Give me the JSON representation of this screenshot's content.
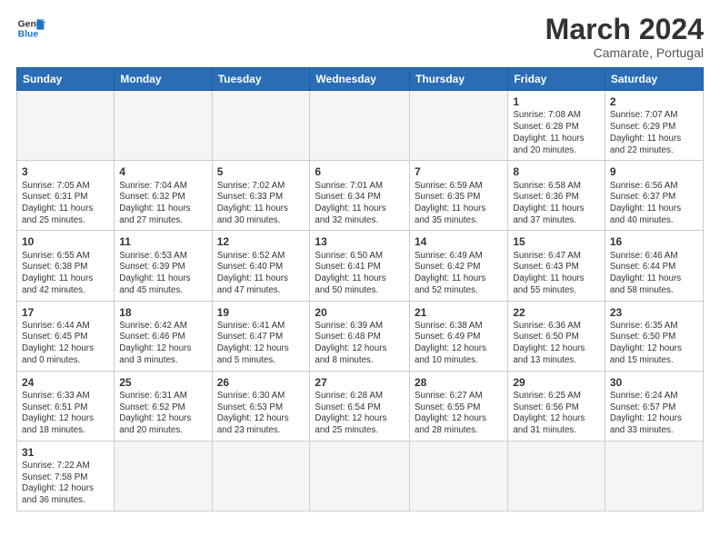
{
  "header": {
    "logo_general": "General",
    "logo_blue": "Blue",
    "title": "March 2024",
    "subtitle": "Camarate, Portugal"
  },
  "weekdays": [
    "Sunday",
    "Monday",
    "Tuesday",
    "Wednesday",
    "Thursday",
    "Friday",
    "Saturday"
  ],
  "weeks": [
    [
      {
        "day": "",
        "info": ""
      },
      {
        "day": "",
        "info": ""
      },
      {
        "day": "",
        "info": ""
      },
      {
        "day": "",
        "info": ""
      },
      {
        "day": "",
        "info": ""
      },
      {
        "day": "1",
        "info": "Sunrise: 7:08 AM\nSunset: 6:28 PM\nDaylight: 11 hours\nand 20 minutes."
      },
      {
        "day": "2",
        "info": "Sunrise: 7:07 AM\nSunset: 6:29 PM\nDaylight: 11 hours\nand 22 minutes."
      }
    ],
    [
      {
        "day": "3",
        "info": "Sunrise: 7:05 AM\nSunset: 6:31 PM\nDaylight: 11 hours\nand 25 minutes."
      },
      {
        "day": "4",
        "info": "Sunrise: 7:04 AM\nSunset: 6:32 PM\nDaylight: 11 hours\nand 27 minutes."
      },
      {
        "day": "5",
        "info": "Sunrise: 7:02 AM\nSunset: 6:33 PM\nDaylight: 11 hours\nand 30 minutes."
      },
      {
        "day": "6",
        "info": "Sunrise: 7:01 AM\nSunset: 6:34 PM\nDaylight: 11 hours\nand 32 minutes."
      },
      {
        "day": "7",
        "info": "Sunrise: 6:59 AM\nSunset: 6:35 PM\nDaylight: 11 hours\nand 35 minutes."
      },
      {
        "day": "8",
        "info": "Sunrise: 6:58 AM\nSunset: 6:36 PM\nDaylight: 11 hours\nand 37 minutes."
      },
      {
        "day": "9",
        "info": "Sunrise: 6:56 AM\nSunset: 6:37 PM\nDaylight: 11 hours\nand 40 minutes."
      }
    ],
    [
      {
        "day": "10",
        "info": "Sunrise: 6:55 AM\nSunset: 6:38 PM\nDaylight: 11 hours\nand 42 minutes."
      },
      {
        "day": "11",
        "info": "Sunrise: 6:53 AM\nSunset: 6:39 PM\nDaylight: 11 hours\nand 45 minutes."
      },
      {
        "day": "12",
        "info": "Sunrise: 6:52 AM\nSunset: 6:40 PM\nDaylight: 11 hours\nand 47 minutes."
      },
      {
        "day": "13",
        "info": "Sunrise: 6:50 AM\nSunset: 6:41 PM\nDaylight: 11 hours\nand 50 minutes."
      },
      {
        "day": "14",
        "info": "Sunrise: 6:49 AM\nSunset: 6:42 PM\nDaylight: 11 hours\nand 52 minutes."
      },
      {
        "day": "15",
        "info": "Sunrise: 6:47 AM\nSunset: 6:43 PM\nDaylight: 11 hours\nand 55 minutes."
      },
      {
        "day": "16",
        "info": "Sunrise: 6:46 AM\nSunset: 6:44 PM\nDaylight: 11 hours\nand 58 minutes."
      }
    ],
    [
      {
        "day": "17",
        "info": "Sunrise: 6:44 AM\nSunset: 6:45 PM\nDaylight: 12 hours\nand 0 minutes."
      },
      {
        "day": "18",
        "info": "Sunrise: 6:42 AM\nSunset: 6:46 PM\nDaylight: 12 hours\nand 3 minutes."
      },
      {
        "day": "19",
        "info": "Sunrise: 6:41 AM\nSunset: 6:47 PM\nDaylight: 12 hours\nand 5 minutes."
      },
      {
        "day": "20",
        "info": "Sunrise: 6:39 AM\nSunset: 6:48 PM\nDaylight: 12 hours\nand 8 minutes."
      },
      {
        "day": "21",
        "info": "Sunrise: 6:38 AM\nSunset: 6:49 PM\nDaylight: 12 hours\nand 10 minutes."
      },
      {
        "day": "22",
        "info": "Sunrise: 6:36 AM\nSunset: 6:50 PM\nDaylight: 12 hours\nand 13 minutes."
      },
      {
        "day": "23",
        "info": "Sunrise: 6:35 AM\nSunset: 6:50 PM\nDaylight: 12 hours\nand 15 minutes."
      }
    ],
    [
      {
        "day": "24",
        "info": "Sunrise: 6:33 AM\nSunset: 6:51 PM\nDaylight: 12 hours\nand 18 minutes."
      },
      {
        "day": "25",
        "info": "Sunrise: 6:31 AM\nSunset: 6:52 PM\nDaylight: 12 hours\nand 20 minutes."
      },
      {
        "day": "26",
        "info": "Sunrise: 6:30 AM\nSunset: 6:53 PM\nDaylight: 12 hours\nand 23 minutes."
      },
      {
        "day": "27",
        "info": "Sunrise: 6:28 AM\nSunset: 6:54 PM\nDaylight: 12 hours\nand 25 minutes."
      },
      {
        "day": "28",
        "info": "Sunrise: 6:27 AM\nSunset: 6:55 PM\nDaylight: 12 hours\nand 28 minutes."
      },
      {
        "day": "29",
        "info": "Sunrise: 6:25 AM\nSunset: 6:56 PM\nDaylight: 12 hours\nand 31 minutes."
      },
      {
        "day": "30",
        "info": "Sunrise: 6:24 AM\nSunset: 6:57 PM\nDaylight: 12 hours\nand 33 minutes."
      }
    ],
    [
      {
        "day": "31",
        "info": "Sunrise: 7:22 AM\nSunset: 7:58 PM\nDaylight: 12 hours\nand 36 minutes."
      },
      {
        "day": "",
        "info": ""
      },
      {
        "day": "",
        "info": ""
      },
      {
        "day": "",
        "info": ""
      },
      {
        "day": "",
        "info": ""
      },
      {
        "day": "",
        "info": ""
      },
      {
        "day": "",
        "info": ""
      }
    ]
  ]
}
